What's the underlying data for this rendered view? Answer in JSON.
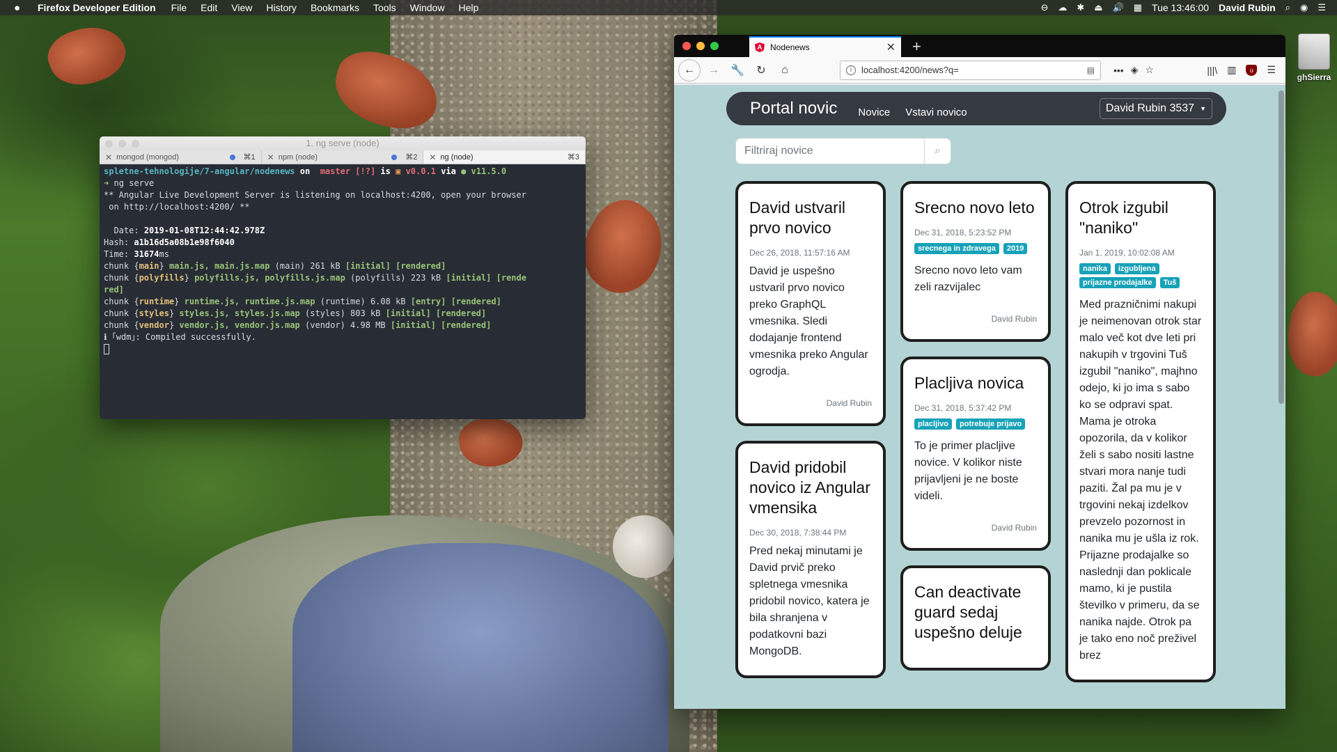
{
  "menubar": {
    "apple": "",
    "app": "Firefox Developer Edition",
    "items": [
      "File",
      "Edit",
      "View",
      "History",
      "Bookmarks",
      "Tools",
      "Window",
      "Help"
    ],
    "clock": "Tue 13:46:00",
    "user": "David Rubin"
  },
  "desktop": {
    "icon_label": "ghSierra"
  },
  "terminal": {
    "title": "1. ng serve (node)",
    "tabs": [
      {
        "label": "mongod (mongod)",
        "shortcut": "⌘1"
      },
      {
        "label": "npm (node)",
        "shortcut": "⌘2"
      },
      {
        "label": "ng (node)",
        "shortcut": "⌘3"
      }
    ],
    "prompt_path": "spletne-tehnologije/7-angular/nodenews",
    "on": "on",
    "branch": " master [!?]",
    "is": "is",
    "pkg_version": "v0.0.1",
    "via": "via",
    "node_version": "● v11.5.0",
    "arrow": "➜",
    "command": "ng serve",
    "serve_line1": "** Angular Live Development Server is listening on localhost:4200, open your browser",
    "serve_line2": " on http://localhost:4200/ **",
    "date_label": "Date:",
    "date_value": "2019-01-08T12:44:42.978Z",
    "hash_label": "Hash:",
    "hash_value": "a1b16d5a08b1e98f6040",
    "time_label": "Time:",
    "time_value": "31674",
    "time_unit": "ms",
    "chunks": [
      {
        "name": "main",
        "files": "main.js, main.js.map",
        "kind": "(main)",
        "size": "261 kB",
        "flags": "[initial] [rendered]"
      },
      {
        "name": "polyfills",
        "files": "polyfills.js, polyfills.js.map",
        "kind": "(polyfills)",
        "size": "223 kB",
        "flags": "[initial] [rende"
      },
      {
        "name": "runtime",
        "files": "runtime.js, runtime.js.map",
        "kind": "(runtime)",
        "size": "6.08 kB",
        "flags": "[entry] [rendered]"
      },
      {
        "name": "styles",
        "files": "styles.js, styles.js.map",
        "kind": "(styles)",
        "size": "803 kB",
        "flags": "[initial] [rendered]"
      },
      {
        "name": "vendor",
        "files": "vendor.js, vendor.js.map",
        "kind": "(vendor)",
        "size": "4.98 MB",
        "flags": "[initial] [rendered]"
      }
    ],
    "polyfills_wrap": "red]",
    "wdm_line": "ℹ ｢wdm｣: Compiled successfully."
  },
  "browser": {
    "tab_title": "Nodenews",
    "url": "localhost:4200/news?q=",
    "page": {
      "brand": "Portal novic",
      "nav_links": [
        "Novice",
        "Vstavi novico"
      ],
      "user_menu": "David Rubin 3537",
      "search_placeholder": "Filtriraj novice",
      "columns": [
        [
          {
            "title": "David ustvaril prvo novico",
            "date": "Dec 26, 2018, 11:57:16 AM",
            "tags": [],
            "body": "David je uspešno ustvaril prvo novico preko GraphQL vmesnika. Sledi dodajanje frontend vmesnika preko Angular ogrodja.",
            "author": "David Rubin"
          },
          {
            "title": "David pridobil novico iz Angular vmensika",
            "date": "Dec 30, 2018, 7:38:44 PM",
            "tags": [],
            "body": "Pred nekaj minutami je David prvič preko spletnega vmesnika pridobil novico, katera je bila shranjena v podatkovni bazi MongoDB.",
            "author": ""
          }
        ],
        [
          {
            "title": "Srecno novo leto",
            "date": "Dec 31, 2018, 5:23:52 PM",
            "tags": [
              "srecnega in zdravega",
              "2019"
            ],
            "body": "Srecno novo leto vam zeli razvijalec",
            "author": "David Rubin"
          },
          {
            "title": "Placljiva novica",
            "date": "Dec 31, 2018, 5:37:42 PM",
            "tags": [
              "placljivo",
              "potrebuje prijavo"
            ],
            "body": "To je primer placljive novice. V kolikor niste prijavljeni je ne boste videli.",
            "author": "David Rubin"
          },
          {
            "title": "Can deactivate guard sedaj uspešno deluje",
            "date": "",
            "tags": [],
            "body": "",
            "author": ""
          }
        ],
        [
          {
            "title": "Otrok izgubil \"naniko\"",
            "date": "Jan 1, 2019, 10:02:08 AM",
            "tags": [
              "nanika",
              "izgubljena",
              "prijazne prodajalke",
              "Tuš"
            ],
            "body": "Med prazničnimi nakupi je neimenovan otrok star malo več kot dve leti pri nakupih v trgovini Tuš izgubil \"naniko\", majhno odejo, ki jo ima s sabo ko se odpravi spat. Mama je otroka opozorila, da v kolikor želi s sabo nositi lastne stvari mora nanje tudi paziti. Žal pa mu je v trgovini nekaj izdelkov prevzelo pozornost in nanika mu je ušla iz rok. Prijazne prodajalke so naslednji dan poklicale mamo, ki je pustila številko v primeru, da se nanika najde. Otrok pa je tako eno noč preživel brez",
            "author": ""
          }
        ]
      ]
    }
  },
  "colors": {
    "navbar": "#353a40",
    "page_bg": "#b4d3d4",
    "badge": "#17a2b8",
    "firefox_accent": "#0a84ff"
  }
}
